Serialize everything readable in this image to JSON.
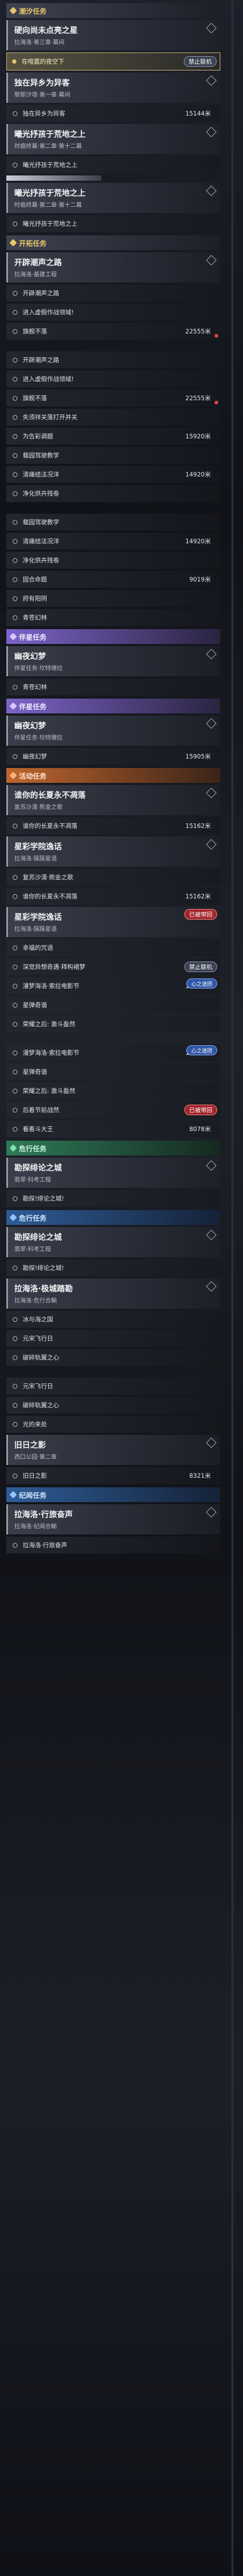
{
  "categories": {
    "main": "潮汐任务",
    "kaituo": "开拓任务",
    "legend": "伴星任务",
    "event": "活动任务",
    "danger": "危行任务",
    "story": "危行任务",
    "story2": "纪闻任务"
  },
  "badges": {
    "lock": "禁止联机",
    "return": "已被带回",
    "flee": "心之迷团",
    "team": "已被带回"
  },
  "items": [
    {
      "kind": "cat",
      "style": "main",
      "label": "潮汐任务"
    },
    {
      "kind": "head",
      "title": "硬向尚未点亮之星",
      "sub": "拉海洛·第三章·幕间"
    },
    {
      "kind": "cur",
      "text": "在喧嚣的夜空下",
      "badge": "禁止联机"
    },
    {
      "kind": "head",
      "title": "独在异乡为异客",
      "sub": "黎那汐塔·第一章·幕间"
    },
    {
      "kind": "obj",
      "text": "独在异乡为异客",
      "dist": "15144米"
    },
    {
      "kind": "head",
      "title": "曦光抒孩于荒地之上",
      "sub": "时痕终幕·第二章·第十二幕"
    },
    {
      "kind": "obj",
      "text": "曦光抒孩于荒地之上",
      "dist": ""
    },
    {
      "kind": "bar"
    },
    {
      "kind": "head",
      "title": "曦光抒孩于荒地之上",
      "sub": "时痕终幕·第二章·第十二幕"
    },
    {
      "kind": "obj",
      "text": "曦光抒孩于荒地之上",
      "dist": ""
    },
    {
      "kind": "cat",
      "style": "main",
      "label": "开拓任务"
    },
    {
      "kind": "head",
      "title": "开辟潮声之路",
      "sub": "拉海洛·基建工程"
    },
    {
      "kind": "obj",
      "text": "开辟潮声之路",
      "dist": ""
    },
    {
      "kind": "obj",
      "text": "进入虚假作战领域!",
      "dist": ""
    },
    {
      "kind": "obj",
      "text": "旗舰不落",
      "dist": "22555米",
      "marker": true
    },
    {
      "kind": "gap"
    },
    {
      "kind": "obj",
      "text": "开辟潮声之路",
      "dist": ""
    },
    {
      "kind": "obj",
      "text": "进入虚假作战领域!",
      "dist": ""
    },
    {
      "kind": "obj",
      "text": "旗舰不落",
      "dist": "22555米",
      "marker": true
    },
    {
      "kind": "obj",
      "text": "失须祥关落打开并关",
      "dist": ""
    },
    {
      "kind": "obj",
      "text": "为告彩调题",
      "dist": "15920米"
    },
    {
      "kind": "obj",
      "text": "载园驾驶教学",
      "dist": ""
    },
    {
      "kind": "obj",
      "text": "清痛结法况洋",
      "dist": "14920米"
    },
    {
      "kind": "obj",
      "text": "净化供卉残卷",
      "dist": ""
    },
    {
      "kind": "gap"
    },
    {
      "kind": "obj",
      "text": "载园驾驶教学",
      "dist": ""
    },
    {
      "kind": "obj",
      "text": "清痛结法况洋",
      "dist": "14920米"
    },
    {
      "kind": "obj",
      "text": "净化供卉残卷",
      "dist": ""
    },
    {
      "kind": "obj",
      "text": "固合命题",
      "dist": "9019米"
    },
    {
      "kind": "obj",
      "text": "府有阳阴",
      "dist": ""
    },
    {
      "kind": "obj",
      "text": "青苍幻林",
      "dist": ""
    },
    {
      "kind": "cat",
      "style": "legend",
      "label": "伴星任务"
    },
    {
      "kind": "head",
      "title": "幽夜幻梦",
      "sub": "伴星任务·坎特珊拉"
    },
    {
      "kind": "obj",
      "text": "青苍幻林",
      "dist": ""
    },
    {
      "kind": "cat",
      "style": "legend",
      "label": "伴星任务"
    },
    {
      "kind": "head",
      "title": "幽夜幻梦",
      "sub": "伴星任务·坎特珊拉"
    },
    {
      "kind": "obj",
      "text": "幽夜幻梦",
      "dist": "15905米"
    },
    {
      "kind": "cat",
      "style": "event",
      "label": "活动任务"
    },
    {
      "kind": "head",
      "title": "谁你的长夏永不凋落",
      "sub": "复苏沙漠·熊金之歌"
    },
    {
      "kind": "obj",
      "text": "谁你的长夏永不凋落",
      "dist": "15162米"
    },
    {
      "kind": "head",
      "title": "星彩学院逸话",
      "sub": "拉海洛·蹊蹊星语"
    },
    {
      "kind": "obj",
      "text": "复苏沙漠·熊金之歌",
      "dist": ""
    },
    {
      "kind": "obj",
      "text": "谁你的长夏永不凋落",
      "dist": "15162米"
    },
    {
      "kind": "head",
      "title": "星彩学院逸话",
      "sub": "拉海洛·蹊蹊星语",
      "badge": "已被带回",
      "badgeStyle": "red"
    },
    {
      "kind": "obj",
      "text": "幸福的咒语",
      "dist": ""
    },
    {
      "kind": "obj",
      "text": "深觉异想奇遇·拜构裙梦",
      "dist": "",
      "badge": "禁止联机"
    },
    {
      "kind": "obj",
      "text": "漫梦海洛·索拉电影节",
      "dist": "16695米",
      "badge": "心之迷团",
      "badgeStyle": "blue"
    },
    {
      "kind": "obj",
      "text": "星弹奇谐",
      "dist": ""
    },
    {
      "kind": "obj",
      "text": "荣耀之后: 激斗盈然",
      "dist": ""
    },
    {
      "kind": "gap"
    },
    {
      "kind": "obj",
      "text": "漫梦海洛·索拉电影节",
      "dist": "16695米",
      "badge": "心之迷团",
      "badgeStyle": "blue"
    },
    {
      "kind": "obj",
      "text": "星弹奇谐",
      "dist": ""
    },
    {
      "kind": "obj",
      "text": "荣耀之后: 激斗盈然",
      "dist": ""
    },
    {
      "kind": "obj",
      "text": "后着节前战然",
      "dist": "",
      "badge": "已被带回",
      "badgeStyle": "red"
    },
    {
      "kind": "obj",
      "text": "看着斗大王",
      "dist": "8078米"
    },
    {
      "kind": "cat",
      "style": "danger",
      "label": "危行任务"
    },
    {
      "kind": "head",
      "title": "勘探绯论之城",
      "sub": "翡翠·科考工程"
    },
    {
      "kind": "obj",
      "text": "勘探!绯论之城!",
      "dist": ""
    },
    {
      "kind": "cat",
      "style": "story",
      "label": "危行任务"
    },
    {
      "kind": "head",
      "title": "勘探绯论之城",
      "sub": "翡翠·科考工程"
    },
    {
      "kind": "obj",
      "text": "勘探!绯论之城!",
      "dist": ""
    },
    {
      "kind": "head",
      "title": "拉海洛·极城踏勘",
      "sub": "拉海洛·危行合輸"
    },
    {
      "kind": "obj",
      "text": "冰与海之国",
      "dist": ""
    },
    {
      "kind": "obj",
      "text": "元宋飞行日",
      "dist": ""
    },
    {
      "kind": "obj",
      "text": "破碎轨翼之心",
      "dist": ""
    },
    {
      "kind": "gap"
    },
    {
      "kind": "obj",
      "text": "元宋飞行日",
      "dist": ""
    },
    {
      "kind": "obj",
      "text": "破碎轨翼之心",
      "dist": ""
    },
    {
      "kind": "obj",
      "text": "光的来处",
      "dist": ""
    },
    {
      "kind": "head",
      "title": "旧日之影",
      "sub": "西口公园·第二章"
    },
    {
      "kind": "obj",
      "text": "旧日之影",
      "dist": "8321米"
    },
    {
      "kind": "cat",
      "style": "story",
      "label": "纪闻任务"
    },
    {
      "kind": "head",
      "title": "拉海洛·行旅奋声",
      "sub": "拉海洛·纪闻合輸"
    },
    {
      "kind": "obj",
      "text": "拉海洛·行旅奋声",
      "dist": ""
    }
  ]
}
